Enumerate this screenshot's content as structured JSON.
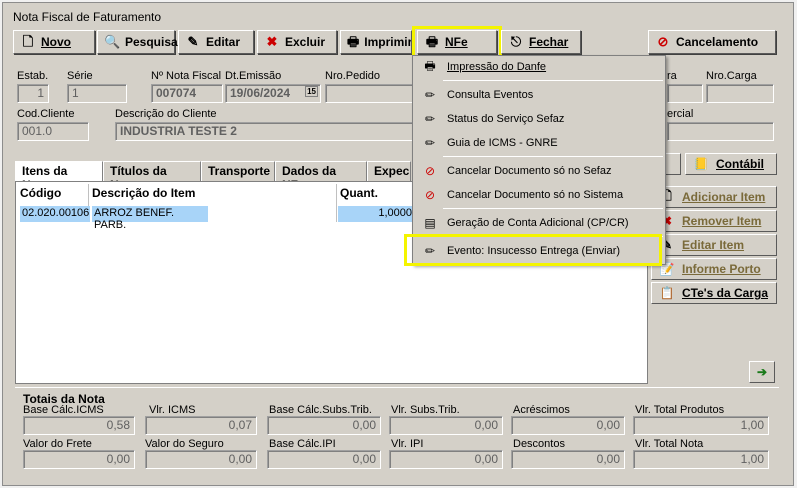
{
  "window": {
    "title": "Nota Fiscal de Faturamento"
  },
  "toolbar": {
    "novo": "Novo",
    "pesquisa": "Pesquisa",
    "editar": "Editar",
    "excluir": "Excluir",
    "imprimir": "Imprimir",
    "nfe": "NFe",
    "fechar": "Fechar",
    "cancelamento": "Cancelamento"
  },
  "header": {
    "estab_label": "Estab.",
    "estab_value": "1",
    "serie_label": "Série",
    "serie_value": "1",
    "nota_label": "Nº Nota Fiscal",
    "nota_value": "007074",
    "dtemissao_label": "Dt.Emissão",
    "dtemissao_value": "19/06/2024",
    "calendar_label": "15",
    "pedido_label": "Nro.Pedido",
    "carga_label": "Nro.Carga",
    "ra_label": "ra",
    "codcliente_label": "Cod.Cliente",
    "codcliente_value": "001.0",
    "desccliente_label": "Descrição do Cliente",
    "desccliente_value": "INDUSTRIA TESTE 2",
    "comercial_label": "ercial"
  },
  "tabs": [
    "Itens da Nota",
    "Títulos da Nota",
    "Transporte",
    "Dados da NFe",
    "Expec"
  ],
  "grid": {
    "headers": {
      "codigo": "Código",
      "descricao": "Descrição do Item",
      "quant": "Quant."
    },
    "rows": [
      {
        "codigo": "02.020.00106",
        "descricao": "ARROZ BENEF. PARB.",
        "quant": "1,0000"
      }
    ]
  },
  "side_buttons": {
    "s": "s",
    "contabil": "Contábil",
    "adicionar": "Adicionar Item",
    "remover": "Remover Item",
    "editar": "Editar Item",
    "informe": "Informe Porto",
    "ctes": "CTe's da Carga"
  },
  "totals": {
    "title": "Totais da Nota",
    "base_icms_label": "Base Cálc.ICMS",
    "base_icms": "0,58",
    "vlr_icms_label": "Vlr. ICMS",
    "vlr_icms": "0,07",
    "base_st_label": "Base Cálc.Subs.Trib.",
    "base_st": "0,00",
    "vlr_st_label": "Vlr. Subs.Trib.",
    "vlr_st": "0,00",
    "acrescimos_label": "Acréscimos",
    "acrescimos": "0,00",
    "total_prod_label": "Vlr. Total Produtos",
    "total_prod": "1,00",
    "frete_label": "Valor do Frete",
    "frete": "0,00",
    "seguro_label": "Valor do Seguro",
    "seguro": "0,00",
    "base_ipi_label": "Base Cálc.IPI",
    "base_ipi": "0,00",
    "vlr_ipi_label": "Vlr. IPI",
    "vlr_ipi": "0,00",
    "descontos_label": "Descontos",
    "descontos": "0,00",
    "total_nota_label": "Vlr. Total Nota",
    "total_nota": "1,00"
  },
  "nfe_menu": [
    "Impressão do Danfe",
    "Consulta Eventos",
    "Status do Serviço Sefaz",
    "Guia de ICMS - GNRE",
    "Cancelar Documento só no Sefaz",
    "Cancelar Documento só no Sistema",
    "Geração de Conta Adicional (CP/CR)",
    "Evento: Insucesso Entrega (Enviar)"
  ],
  "colors": {
    "highlight": "#f4f400",
    "selection": "#a8d4f8"
  }
}
